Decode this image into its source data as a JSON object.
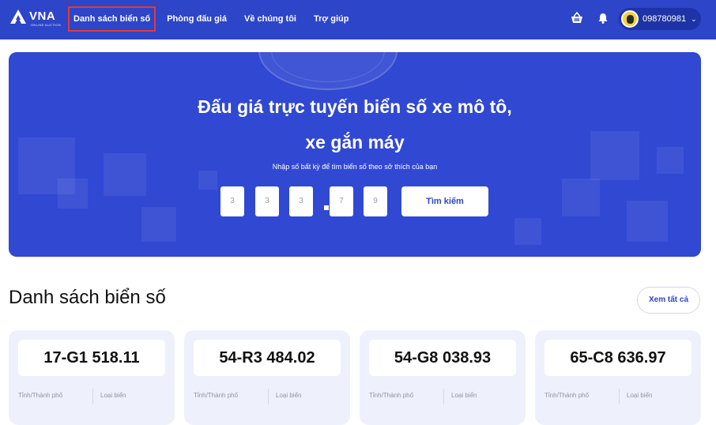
{
  "brand": {
    "name": "VNA",
    "tagline": "ONLINE AUCTION"
  },
  "nav": {
    "items": [
      {
        "label": "Danh sách biển số",
        "active": true
      },
      {
        "label": "Phòng đấu giá"
      },
      {
        "label": "Về chúng tôi"
      },
      {
        "label": "Trợ giúp"
      }
    ]
  },
  "header": {
    "cart_icon": "basket-icon",
    "bell_icon": "bell-icon",
    "user_phone": "098780981",
    "user_caret": "⌄"
  },
  "hero": {
    "title_line1": "Đấu giá trực tuyến biển số xe mô tô,",
    "title_line2": "xe gắn máy",
    "subtitle": "Nhập số bất kỳ để tìm biển số theo sở thích của bạn",
    "placeholders": [
      "3",
      "3",
      "3",
      "7",
      "9"
    ],
    "search_label": "Tìm kiếm"
  },
  "list": {
    "title": "Danh sách biển số",
    "see_all": "Xem tất cả",
    "cards": [
      {
        "plate": "17-G1 518.11",
        "province_label": "Tỉnh/Thành phố",
        "type_label": "Loại biển"
      },
      {
        "plate": "54-R3 484.02",
        "province_label": "Tỉnh/Thành phố",
        "type_label": "Loại biển"
      },
      {
        "plate": "54-G8 038.93",
        "province_label": "Tỉnh/Thành phố",
        "type_label": "Loại biển"
      },
      {
        "plate": "65-C8 636.97",
        "province_label": "Tỉnh/Thành phố",
        "type_label": "Loại biển"
      }
    ]
  },
  "colors": {
    "primary": "#2d45c9",
    "hero": "#3048d2",
    "card_bg": "#eef1fb",
    "active_outline": "#e53935"
  }
}
